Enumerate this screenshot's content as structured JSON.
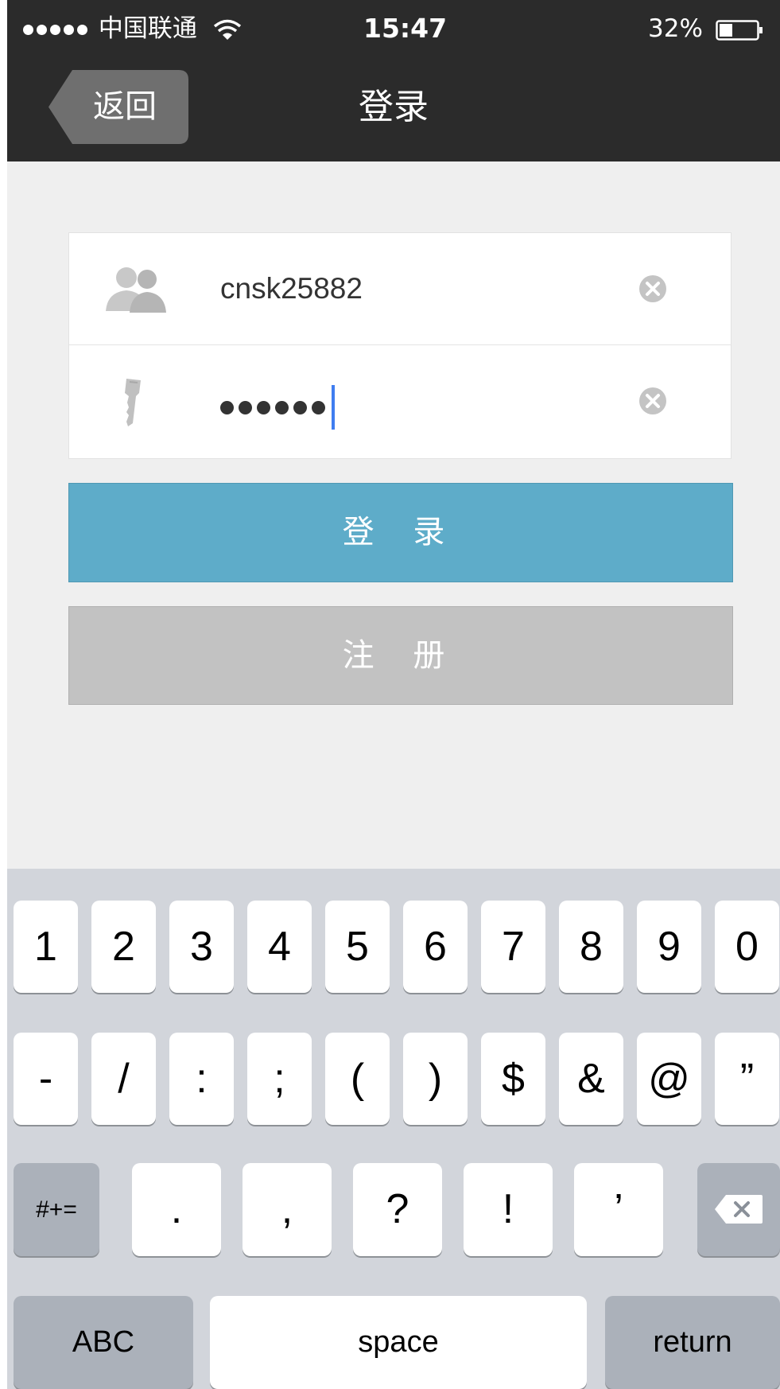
{
  "status_bar": {
    "carrier": "中国联通",
    "time": "15:47",
    "battery": "32%"
  },
  "nav": {
    "back_label": "返回",
    "title": "登录"
  },
  "form": {
    "username_value": "cnsk25882",
    "password_mask_count": 6
  },
  "buttons": {
    "login_label": "登 录",
    "register_label": "注 册"
  },
  "keyboard": {
    "row1": [
      "1",
      "2",
      "3",
      "4",
      "5",
      "6",
      "7",
      "8",
      "9",
      "0"
    ],
    "row2": [
      "-",
      "/",
      ":",
      ";",
      "(",
      ")",
      "$",
      "&",
      "@",
      "”"
    ],
    "row3_shift": "#+=",
    "row3": [
      ".",
      ",",
      "?",
      "!",
      "’"
    ],
    "abc": "ABC",
    "space": "space",
    "return": "return"
  },
  "colors": {
    "navbar": "#2b2b2b",
    "login_button": "#5eacc9",
    "register_button": "#c2c2c2",
    "caret": "#3f7df0"
  }
}
